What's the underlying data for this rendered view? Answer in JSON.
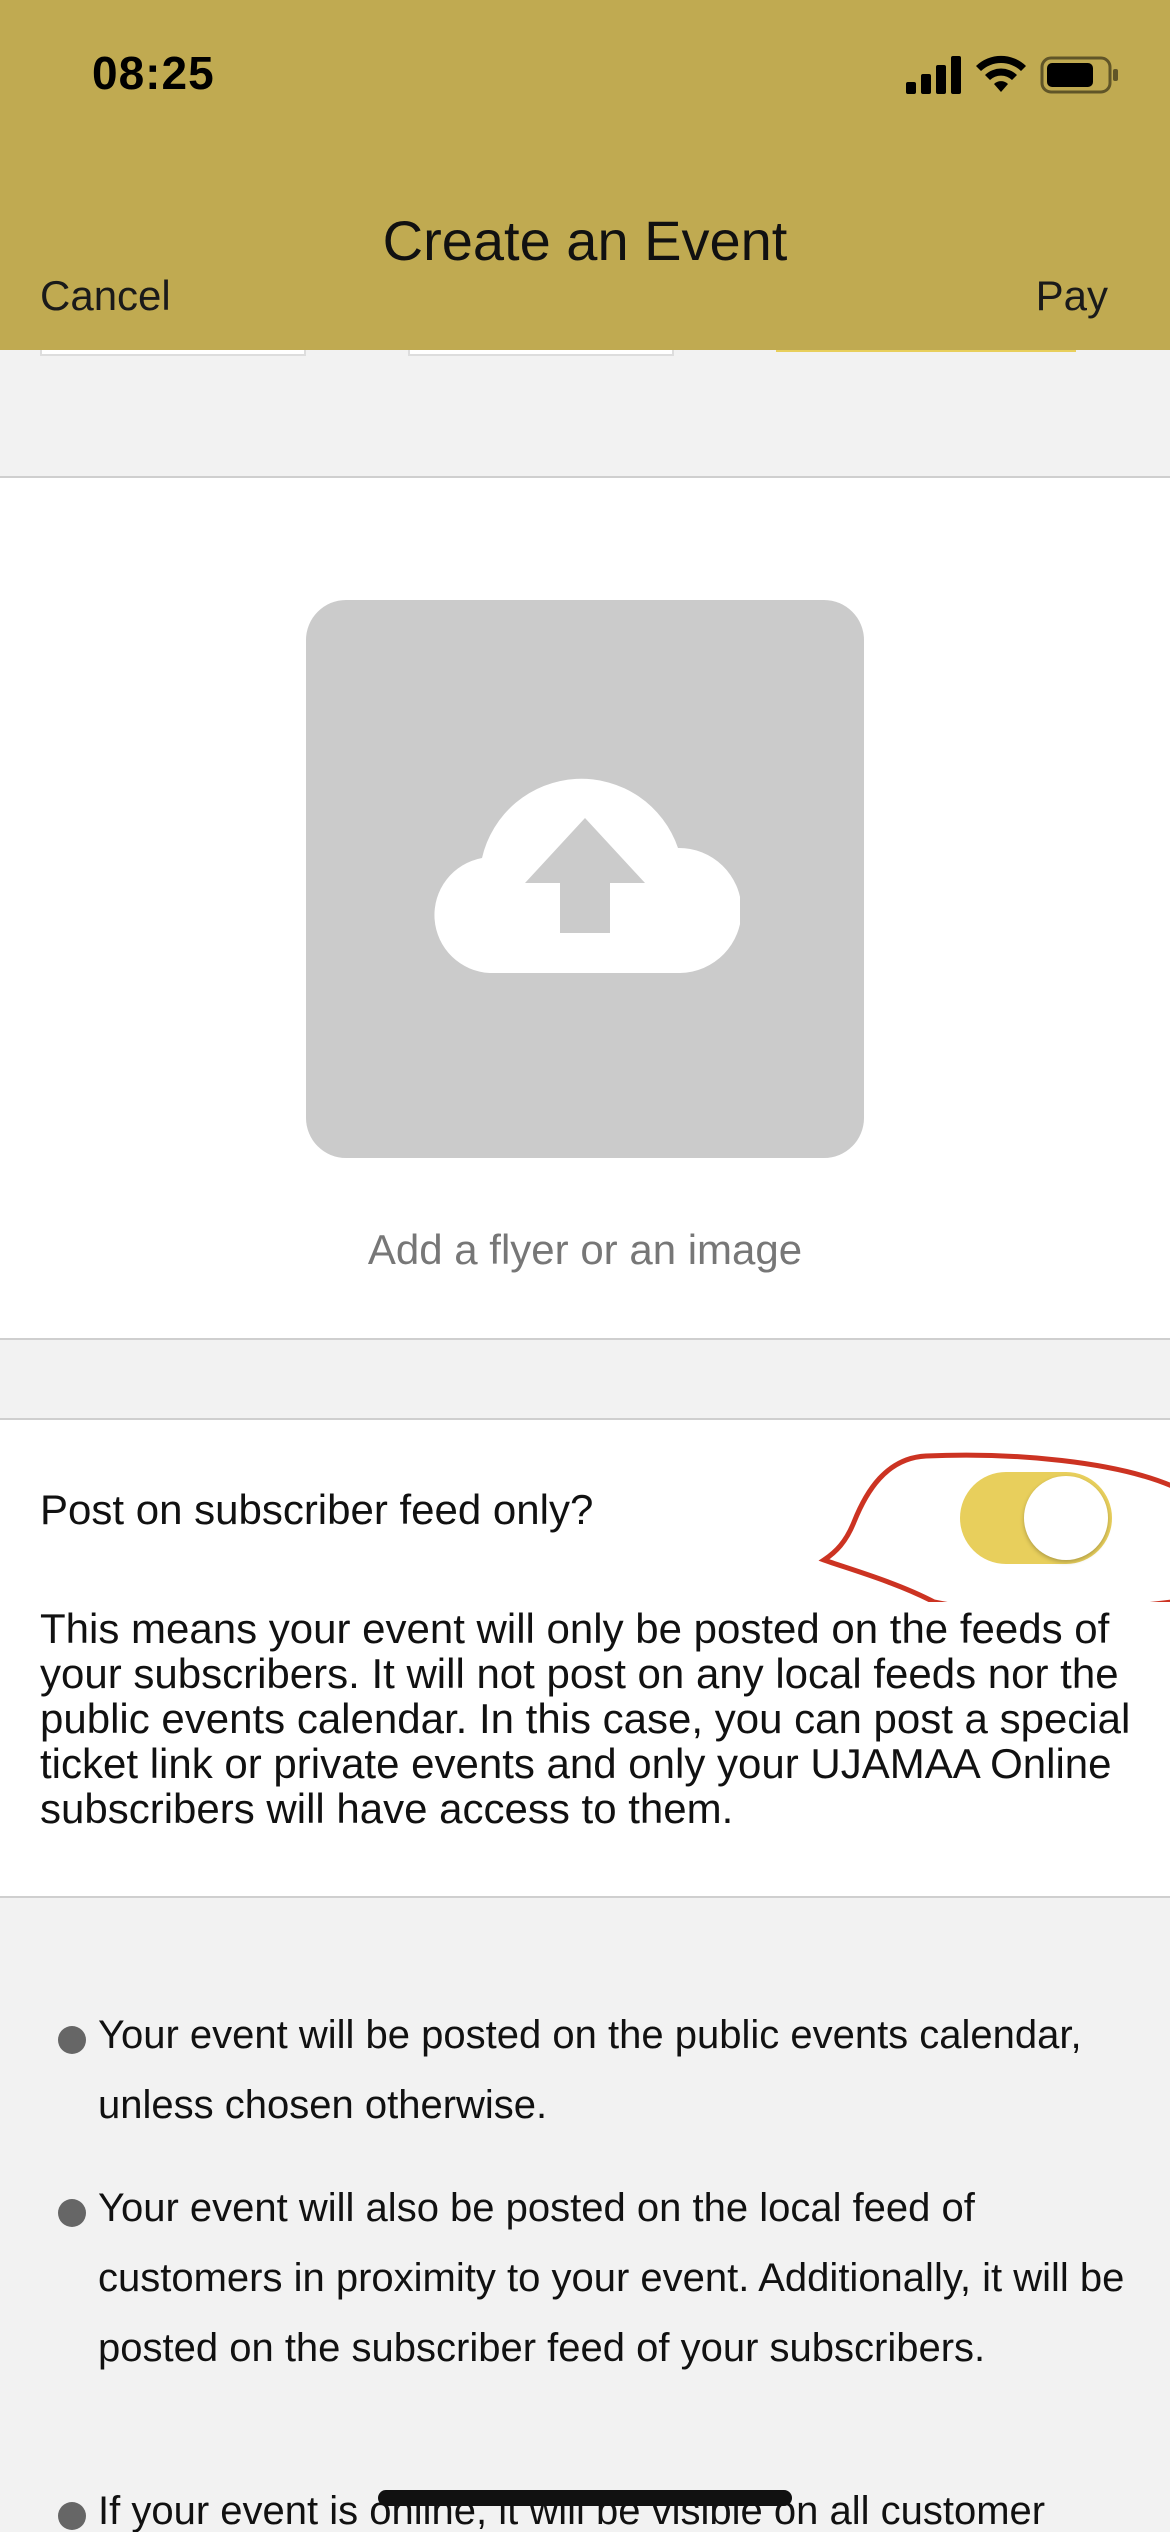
{
  "status_bar": {
    "time": "08:25"
  },
  "header": {
    "title": "Create an Event",
    "cancel_label": "Cancel",
    "pay_label": "Pay",
    "background_color": "#c0aa51"
  },
  "upload": {
    "caption": "Add a flyer or an image",
    "icon": "cloud-upload-icon"
  },
  "subscriber_toggle": {
    "label": "Post on subscriber feed only?",
    "checked": true,
    "accent_color": "#e8cf5c",
    "description": "This means your event will only be posted on the feeds of your subscribers. It will not post on any local feeds nor the public events calendar. In this case, you can post a special ticket link or private events and only your UJAMAA Online subscribers will have access to them."
  },
  "info_list": [
    {
      "text": "Your event will be posted on the public events calendar, unless chosen otherwise."
    },
    {
      "text": "Your event will also be posted on the local feed of customers in proximity to your event. Additionally, it will be posted on the subscriber feed of your subscribers."
    },
    {
      "text": "If your event is online, it will be visible on all customer"
    }
  ],
  "annotation_color": "#cc3322"
}
